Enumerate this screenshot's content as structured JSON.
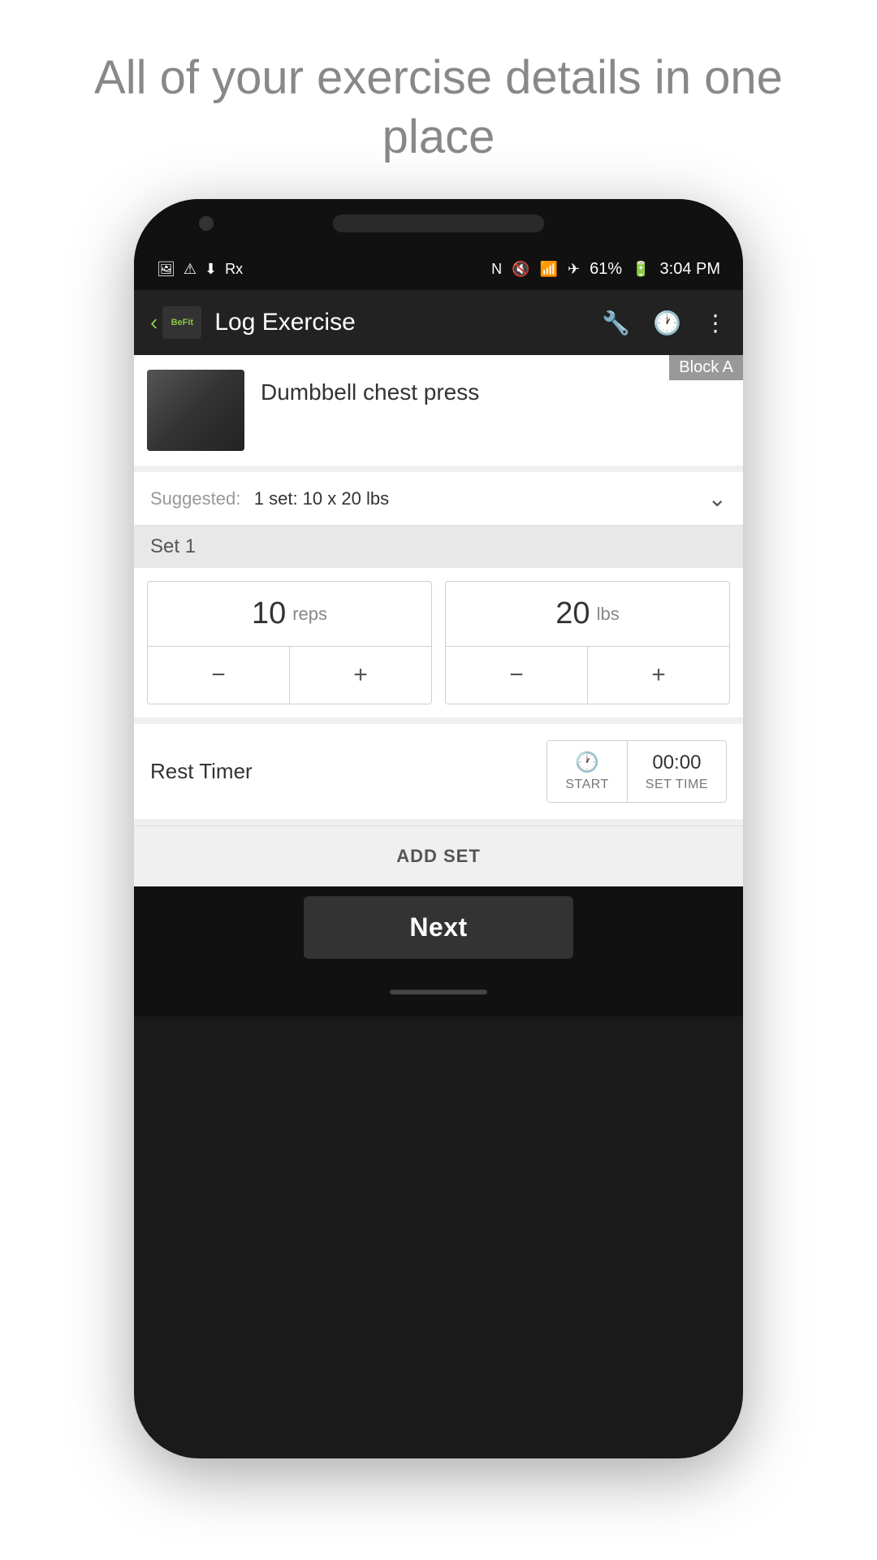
{
  "page": {
    "header_text": "All of your exercise\ndetails in one place"
  },
  "status_bar": {
    "time": "3:04 PM",
    "battery": "61%",
    "icons_left": [
      "image-icon",
      "warning-icon",
      "download-icon",
      "unknown-icon"
    ],
    "icons_right": [
      "nfc-icon",
      "mute-icon",
      "wifi-icon",
      "airplane-icon",
      "battery-icon"
    ]
  },
  "toolbar": {
    "title": "Log Exercise",
    "back_label": "‹",
    "logo_text": "BeFit",
    "wrench_icon": "🔧",
    "history_icon": "⟳",
    "more_icon": "⋮"
  },
  "exercise": {
    "name": "Dumbbell chest press",
    "block_badge": "Block A",
    "suggested_label": "Suggested:",
    "suggested_value": "1 set: 10 x 20 lbs"
  },
  "sets": [
    {
      "label": "Set 1",
      "reps_value": "10",
      "reps_unit": "reps",
      "weight_value": "20",
      "weight_unit": "lbs",
      "decrease_label": "−",
      "increase_label": "+"
    }
  ],
  "rest_timer": {
    "label": "Rest Timer",
    "start_label": "START",
    "set_time_value": "00:00",
    "set_time_label": "SET TIME"
  },
  "add_set": {
    "label": "ADD SET"
  },
  "bottom": {
    "next_label": "Next"
  }
}
